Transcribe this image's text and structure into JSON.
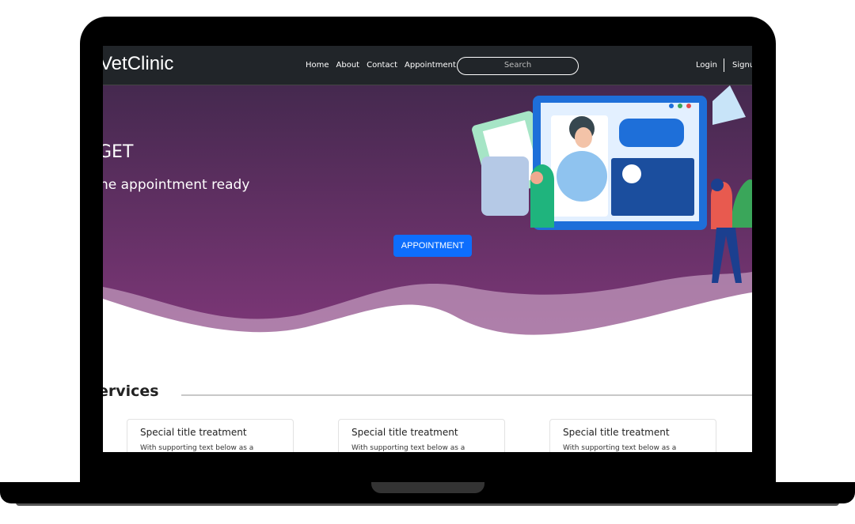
{
  "navbar": {
    "brand": "VetClinic",
    "links": [
      "Home",
      "About",
      "Contact",
      "Appointment"
    ],
    "search_placeholder": "Search",
    "login": "Login",
    "signup": "Signu"
  },
  "hero": {
    "title": "GET",
    "subtitle": "he appointment ready",
    "button": "APPOINTMENT"
  },
  "services": {
    "heading": "ervices",
    "cards": [
      {
        "title": "Special title treatment",
        "text": "With supporting text below as a"
      },
      {
        "title": "Special title treatment",
        "text": "With supporting text below as a"
      },
      {
        "title": "Special title treatment",
        "text": "With supporting text below as a"
      }
    ]
  }
}
